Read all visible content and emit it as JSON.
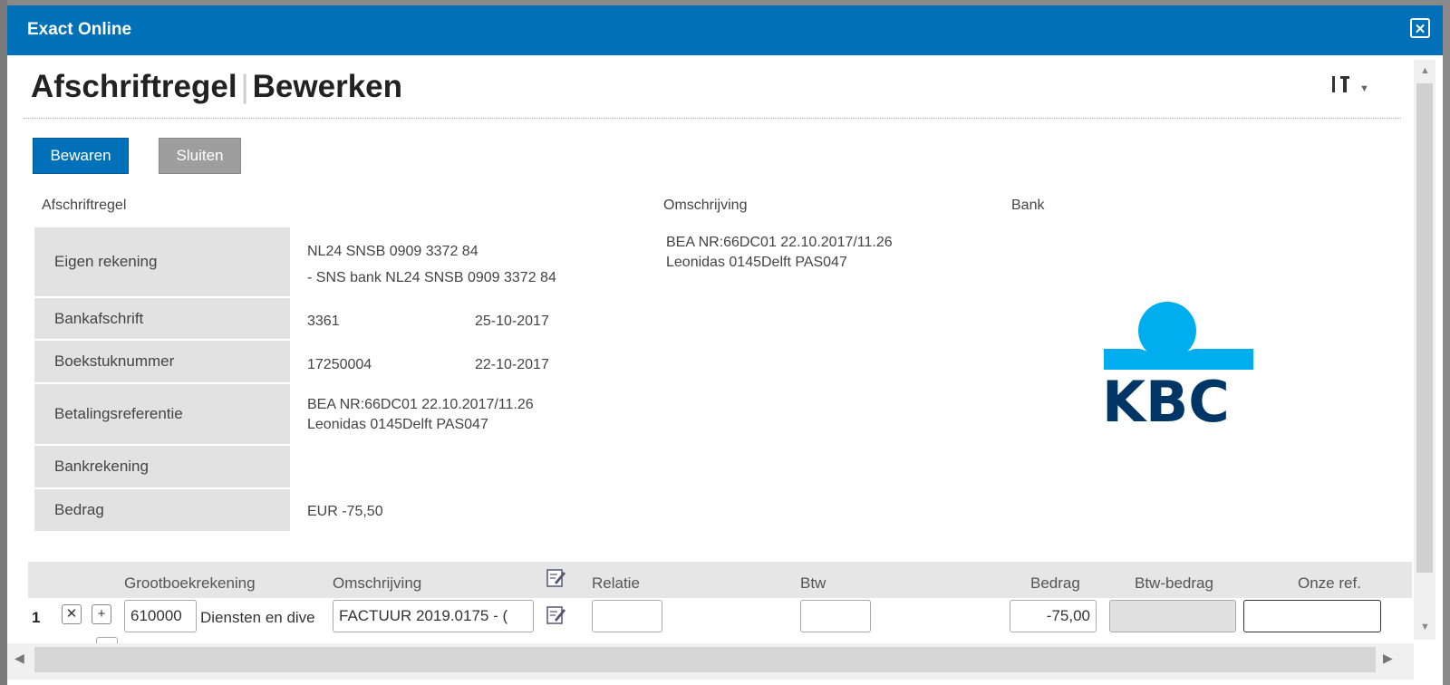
{
  "window": {
    "app_title": "Exact Online"
  },
  "page": {
    "title_main": "Afschriftregel",
    "title_separator": "|",
    "title_action": "Bewerken"
  },
  "toolbar": {
    "save_label": "Bewaren",
    "close_label": "Sluiten"
  },
  "sections": {
    "left": "Afschriftregel",
    "middle": "Omschrijving",
    "right": "Bank"
  },
  "fields": {
    "eigen_rekening": {
      "label": "Eigen rekening",
      "line1": "NL24 SNSB 0909 3372 84",
      "line2": "- SNS bank NL24 SNSB 0909 3372 84"
    },
    "bankafschrift": {
      "label": "Bankafschrift",
      "number": "3361",
      "date": "25-10-2017"
    },
    "boekstuknummer": {
      "label": "Boekstuknummer",
      "number": "17250004",
      "date": "22-10-2017"
    },
    "betalingsreferentie": {
      "label": "Betalingsreferentie",
      "line1": "BEA NR:66DC01 22.10.2017/11.26",
      "line2": "Leonidas 0145Delft PAS047"
    },
    "bankrekening": {
      "label": "Bankrekening",
      "value": ""
    },
    "bedrag": {
      "label": "Bedrag",
      "value": "EUR -75,50"
    }
  },
  "description": {
    "line1": "BEA NR:66DC01 22.10.2017/11.26",
    "line2": "Leonidas 0145Delft PAS047"
  },
  "bank_logo": {
    "text": "KBC",
    "color_primary": "#003665",
    "color_accent": "#00aeef"
  },
  "grid": {
    "columns": {
      "grootboekrekening": "Grootboekrekening",
      "omschrijving": "Omschrijving",
      "relatie": "Relatie",
      "btw": "Btw",
      "bedrag": "Bedrag",
      "btw_bedrag": "Btw-bedrag",
      "onze_ref": "Onze ref."
    },
    "rows": [
      {
        "number": "1",
        "account_code": "610000",
        "account_name": "Diensten en dive",
        "description": "FACTUUR 2019.0175 - (",
        "relatie": "",
        "btw": "",
        "bedrag": "-75,00",
        "btw_bedrag": "",
        "onze_ref": ""
      }
    ]
  },
  "colors": {
    "titlebar": "#0071b9",
    "save_button": "#0071b9",
    "close_button": "#9e9e9e",
    "label_bg": "#e2e2e2"
  }
}
